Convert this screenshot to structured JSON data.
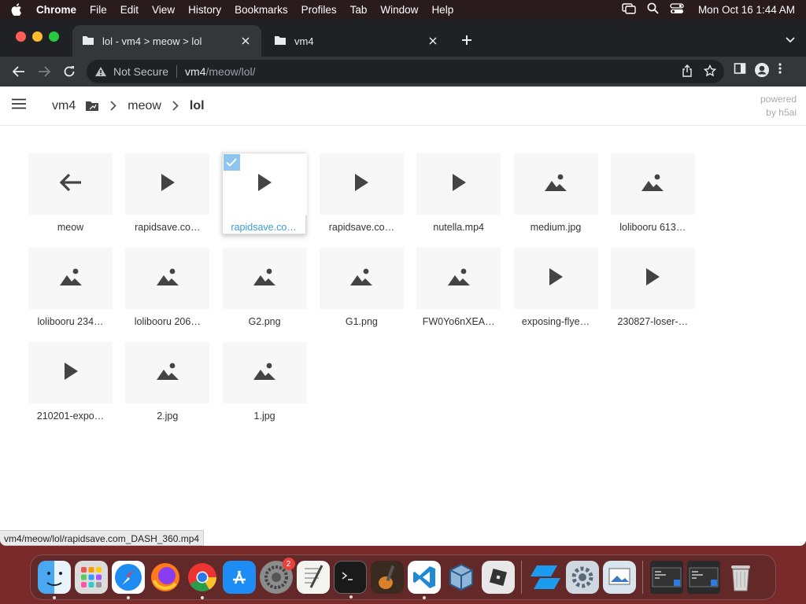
{
  "menubar": {
    "app": "Chrome",
    "items": [
      "File",
      "Edit",
      "View",
      "History",
      "Bookmarks",
      "Profiles",
      "Tab",
      "Window",
      "Help"
    ],
    "clock": "Mon Oct 16  1:44 AM"
  },
  "tabs": [
    {
      "title": "lol - vm4 > meow > lol",
      "active": true
    },
    {
      "title": "vm4",
      "active": false
    }
  ],
  "omnibox": {
    "security": "Not Secure",
    "host": "vm4",
    "path": "/meow/lol/"
  },
  "breadcrumb": {
    "root": "vm4",
    "middle": "meow",
    "current": "lol"
  },
  "powered": {
    "line1": "powered",
    "line2": "by h5ai"
  },
  "items": [
    {
      "name": "meow",
      "icon": "back-arrow-icon"
    },
    {
      "name": "rapidsave.co…",
      "icon": "play-icon"
    },
    {
      "name": "rapidsave.co…",
      "icon": "play-icon",
      "selected": true
    },
    {
      "name": "rapidsave.co…",
      "icon": "play-icon"
    },
    {
      "name": "nutella.mp4",
      "icon": "play-icon"
    },
    {
      "name": "medium.jpg",
      "icon": "image-icon"
    },
    {
      "name": "lolibooru 613…",
      "icon": "image-icon"
    },
    {
      "name": "lolibooru 234…",
      "icon": "image-icon"
    },
    {
      "name": "lolibooru 206…",
      "icon": "image-icon"
    },
    {
      "name": "G2.png",
      "icon": "image-icon"
    },
    {
      "name": "G1.png",
      "icon": "image-icon"
    },
    {
      "name": "FW0Yo6nXEA…",
      "icon": "image-icon"
    },
    {
      "name": "exposing-flye…",
      "icon": "play-icon"
    },
    {
      "name": "230827-loser-…",
      "icon": "play-icon"
    },
    {
      "name": "210201-expo…",
      "icon": "play-icon"
    },
    {
      "name": "2.jpg",
      "icon": "image-icon"
    },
    {
      "name": "1.jpg",
      "icon": "image-icon"
    }
  ],
  "status": "vm4/meow/lol/rapidsave.com_DASH_360.mp4",
  "dock": {
    "apps": [
      "finder",
      "launchpad",
      "safari",
      "firefox",
      "chrome",
      "app-store",
      "system-settings",
      "textedit",
      "terminal",
      "garageband",
      "vscode",
      "virtualbox",
      "roblox",
      "roblox-studio",
      "utility",
      "preview"
    ],
    "settings_badge": "2"
  }
}
